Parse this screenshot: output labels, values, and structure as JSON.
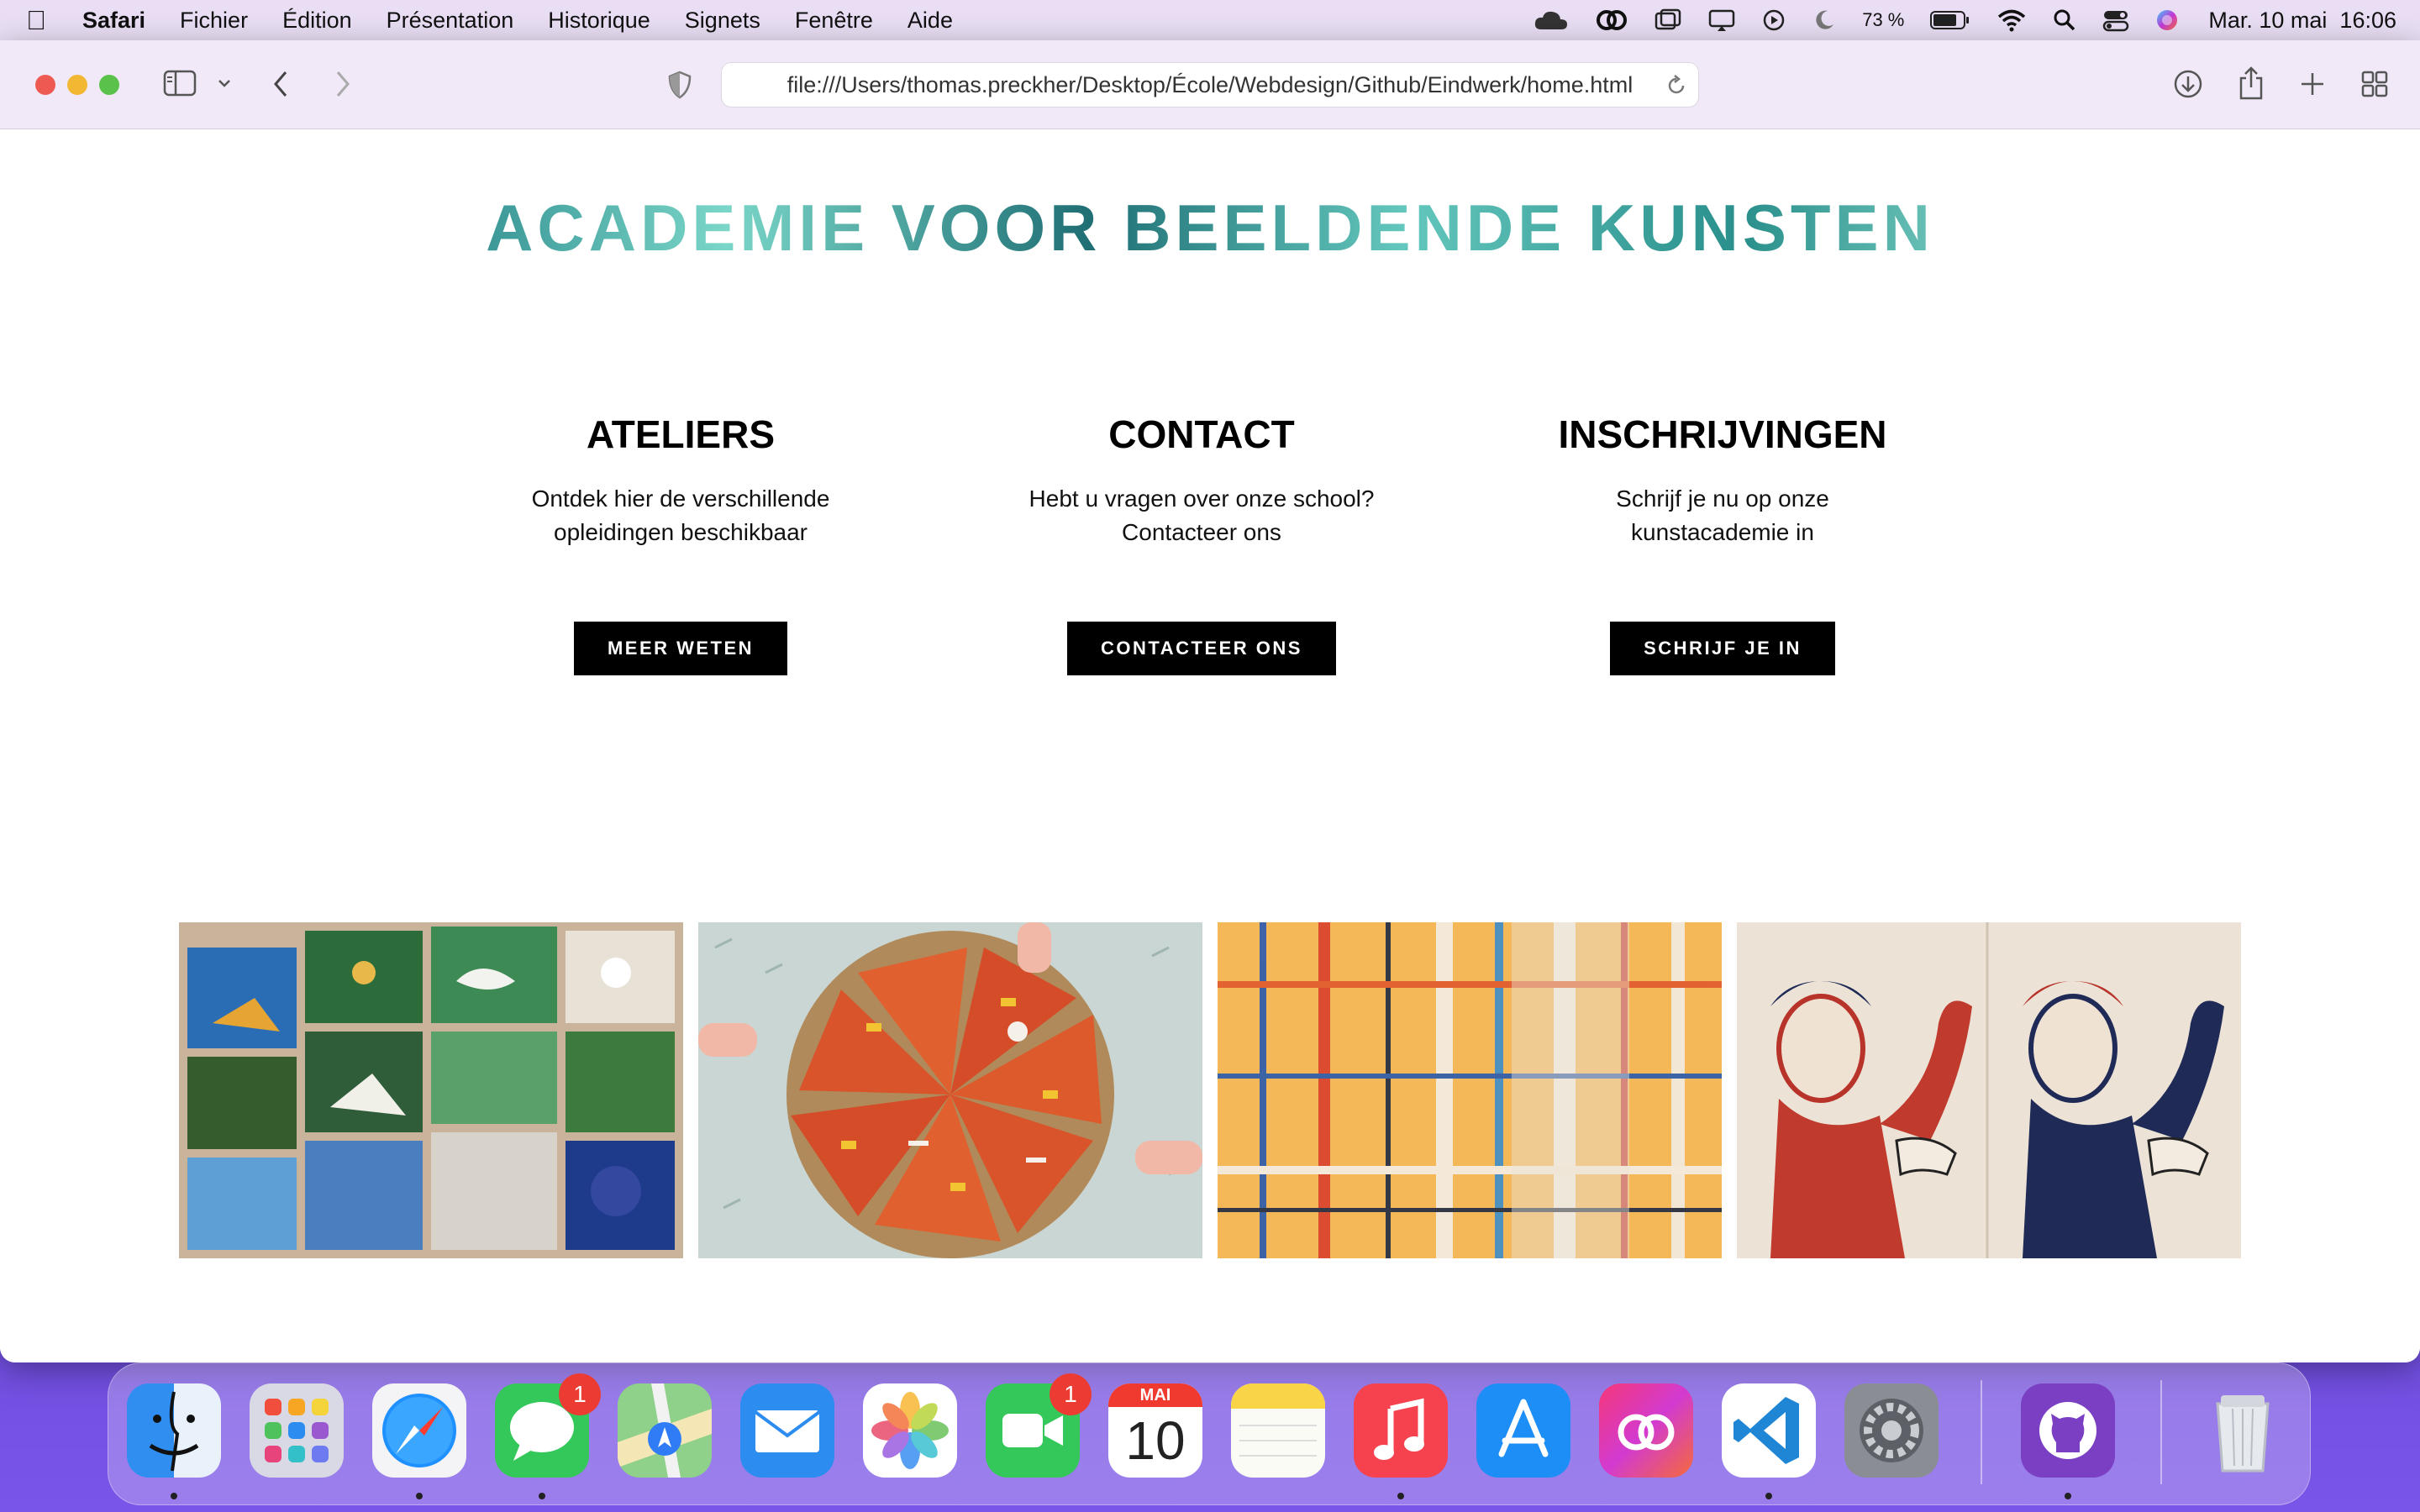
{
  "menubar": {
    "app_name": "Safari",
    "items": [
      "Fichier",
      "Édition",
      "Présentation",
      "Historique",
      "Signets",
      "Fenêtre",
      "Aide"
    ],
    "battery_percent": "73 %",
    "datetime": "Mar. 10 mai  16:06"
  },
  "browser": {
    "url": "file:///Users/thomas.preckher/Desktop/École/Webdesign/Github/Eindwerk/home.html"
  },
  "page": {
    "title": "ACADEMIE VOOR BEELDENDE KUNSTEN",
    "columns": [
      {
        "heading": "ATELIERS",
        "text": "Ontdek hier de verschillende opleidingen beschikbaar",
        "button": "MEER WETEN"
      },
      {
        "heading": "CONTACT",
        "text": "Hebt u vragen over onze school? Contacteer ons",
        "button": "CONTACTEER ONS"
      },
      {
        "heading": "INSCHRIJVINGEN",
        "text": "Schrijf je nu op onze kunstacademie in",
        "button": "SCHRIJF JE IN"
      }
    ]
  },
  "dock": {
    "apps": [
      "finder",
      "launchpad",
      "safari",
      "messages",
      "maps",
      "mail",
      "photos",
      "facetime",
      "calendar",
      "notes",
      "music",
      "app-store",
      "creative-cloud",
      "vscode",
      "system-preferences",
      "github-desktop",
      "trash"
    ],
    "badges": {
      "messages": "1",
      "facetime": "1"
    },
    "calendar_month": "MAI",
    "calendar_day": "10"
  },
  "colors": {
    "title_gradient": [
      "#5bc6c0",
      "#2e8b8d",
      "#7ad6c8",
      "#1f6f74"
    ],
    "button_bg": "#000000",
    "menubar_bg": "#e9def4"
  }
}
